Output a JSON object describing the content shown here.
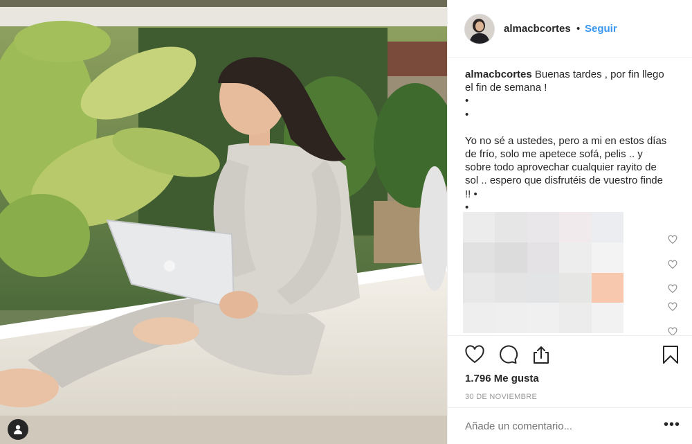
{
  "post": {
    "username": "almacbcortes",
    "separator": "•",
    "follow_label": "Seguir",
    "caption_lines": [
      "Buenas tardes , por fin llego",
      "el fin de semana !",
      "•",
      "•",
      "",
      "Yo no sé a ustedes, pero a mi en estos días",
      "de frío, solo me apetece sofá, pelis .. y",
      "sobre todo aprovechar cualquier rayito de",
      "sol .. espero que disfrutéis de vuestro finde",
      "!! •",
      "•"
    ],
    "likes_text": "1.796 Me gusta",
    "date_text": "30 DE NOVIEMBRE",
    "comment_placeholder": "Añade un comentario...",
    "more_label": "•••"
  },
  "icons": {
    "like": "heart-icon",
    "comment": "comment-icon",
    "share": "share-icon",
    "save": "bookmark-icon",
    "tag": "user-tag-icon"
  },
  "colors": {
    "accent": "#3897f0",
    "text": "#262626",
    "muted": "#999999",
    "border": "#efefef"
  }
}
